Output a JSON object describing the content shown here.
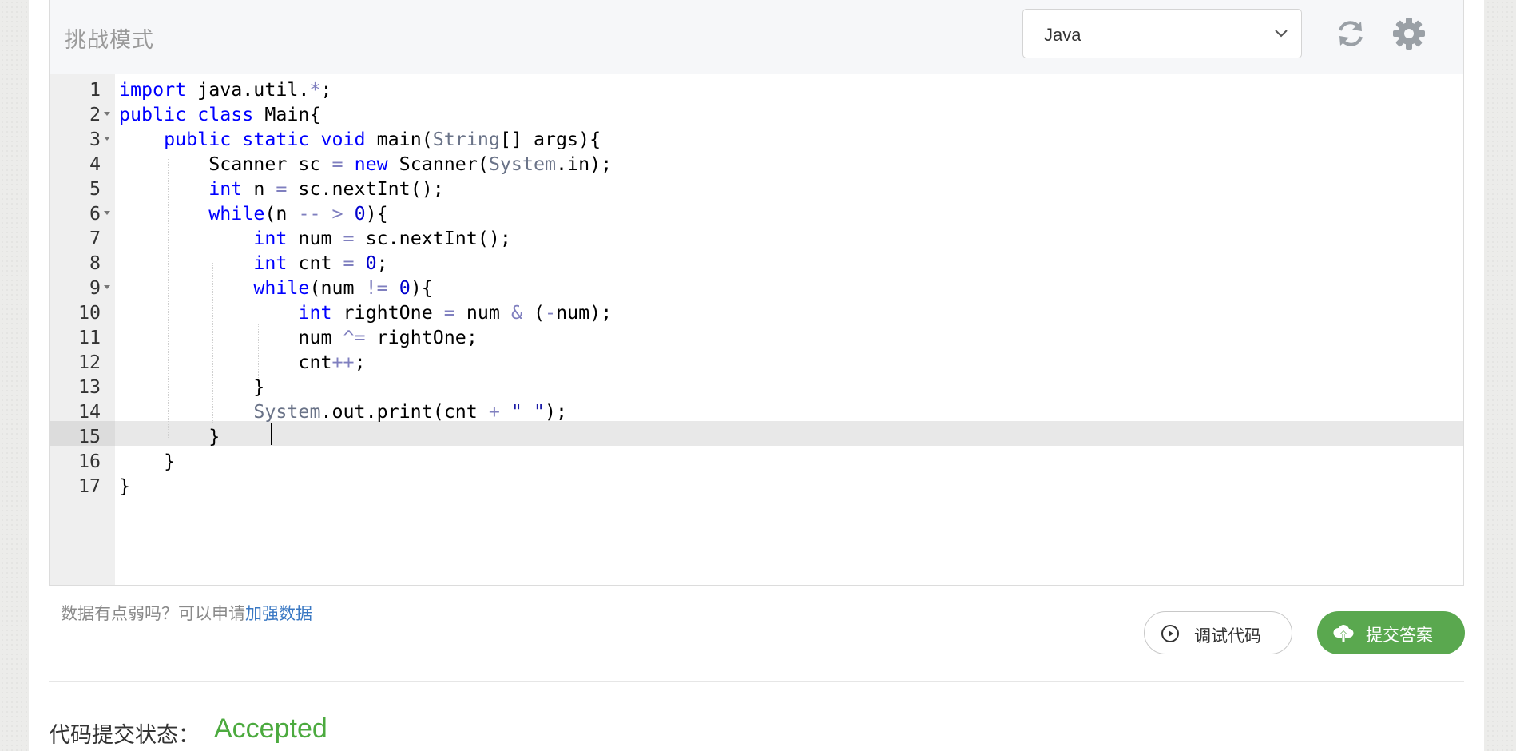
{
  "header": {
    "mode_title": "挑战模式",
    "language": "Java"
  },
  "editor": {
    "active_line": 15,
    "lines": [
      {
        "n": "1",
        "fold": false,
        "html": "<span class=\"kw\">import</span> java.util.<span class=\"op\">*</span>;"
      },
      {
        "n": "2",
        "fold": true,
        "html": "<span class=\"kw\">public</span> <span class=\"kw\">class</span> Main{"
      },
      {
        "n": "3",
        "fold": true,
        "html": "    <span class=\"kw\">public</span> <span class=\"kw\">static</span> <span class=\"kw\">void</span> main(<span class=\"ty\">String</span>[] args){"
      },
      {
        "n": "4",
        "fold": false,
        "html": "        Scanner sc <span class=\"op\">=</span> <span class=\"kw\">new</span> Scanner(<span class=\"ty\">System</span>.in);"
      },
      {
        "n": "5",
        "fold": false,
        "html": "        <span class=\"kw\">int</span> n <span class=\"op\">=</span> sc.nextInt();"
      },
      {
        "n": "6",
        "fold": true,
        "html": "        <span class=\"kw\">while</span>(n <span class=\"op\">--</span> <span class=\"op\">&gt;</span> <span class=\"num\">0</span>){"
      },
      {
        "n": "7",
        "fold": false,
        "html": "            <span class=\"kw\">int</span> num <span class=\"op\">=</span> sc.nextInt();"
      },
      {
        "n": "8",
        "fold": false,
        "html": "            <span class=\"kw\">int</span> cnt <span class=\"op\">=</span> <span class=\"num\">0</span>;"
      },
      {
        "n": "9",
        "fold": true,
        "html": "            <span class=\"kw\">while</span>(num <span class=\"op\">!=</span> <span class=\"num\">0</span>){"
      },
      {
        "n": "10",
        "fold": false,
        "html": "                <span class=\"kw\">int</span> rightOne <span class=\"op\">=</span> num <span class=\"op\">&amp;</span> (<span class=\"op\">-</span>num);"
      },
      {
        "n": "11",
        "fold": false,
        "html": "                num <span class=\"op\">^=</span> rightOne;"
      },
      {
        "n": "12",
        "fold": false,
        "html": "                cnt<span class=\"op\">++</span>;"
      },
      {
        "n": "13",
        "fold": false,
        "html": "            }"
      },
      {
        "n": "14",
        "fold": false,
        "html": "            <span class=\"ty\">System</span>.out.print(cnt <span class=\"op\">+</span> <span class=\"str\">\" \"</span>);"
      },
      {
        "n": "15",
        "fold": false,
        "html": "        }"
      },
      {
        "n": "16",
        "fold": false,
        "html": "    }"
      },
      {
        "n": "17",
        "fold": false,
        "html": "}"
      }
    ]
  },
  "footer": {
    "hint_text": "数据有点弱吗？可以申请",
    "hint_link": "加强数据",
    "debug_label": "调试代码",
    "submit_label": "提交答案",
    "status_label": "代码提交状态：",
    "status_value": "Accepted",
    "status_color": "#4caa3f",
    "submit_color": "#5aa84f"
  }
}
